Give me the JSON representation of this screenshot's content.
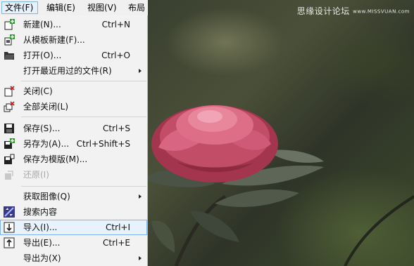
{
  "menubar": {
    "items": [
      {
        "label": "文件(F)"
      },
      {
        "label": "编辑(E)"
      },
      {
        "label": "视图(V)"
      },
      {
        "label": "布局("
      }
    ]
  },
  "file_menu": {
    "items": [
      {
        "label": "新建(N)...",
        "shortcut": "Ctrl+N",
        "icon": "new-document-icon"
      },
      {
        "label": "从模板新建(F)...",
        "shortcut": "",
        "icon": "new-from-template-icon"
      },
      {
        "label": "打开(O)...",
        "shortcut": "Ctrl+O",
        "icon": "open-folder-icon"
      },
      {
        "label": "打开最近用过的文件(R)",
        "shortcut": "",
        "icon": ""
      },
      {
        "label": "关闭(C)",
        "shortcut": "",
        "icon": "close-document-icon"
      },
      {
        "label": "全部关闭(L)",
        "shortcut": "",
        "icon": "close-all-icon"
      },
      {
        "label": "保存(S)...",
        "shortcut": "Ctrl+S",
        "icon": "save-icon"
      },
      {
        "label": "另存为(A)...",
        "shortcut": "Ctrl+Shift+S",
        "icon": "save-as-icon"
      },
      {
        "label": "保存为模版(M)...",
        "shortcut": "",
        "icon": "save-as-template-icon"
      },
      {
        "label": "还原(I)",
        "shortcut": "",
        "icon": "revert-icon"
      },
      {
        "label": "获取图像(Q)",
        "shortcut": "",
        "icon": ""
      },
      {
        "label": "搜索内容",
        "shortcut": "",
        "icon": "search-content-icon"
      },
      {
        "label": "导入(I)...",
        "shortcut": "Ctrl+I",
        "icon": "import-icon"
      },
      {
        "label": "导出(E)...",
        "shortcut": "Ctrl+E",
        "icon": "export-icon"
      },
      {
        "label": "导出为(X)",
        "shortcut": "",
        "icon": ""
      }
    ]
  },
  "watermark": {
    "text": "思缘设计论坛",
    "small": "www.MISSVUAN.com"
  }
}
